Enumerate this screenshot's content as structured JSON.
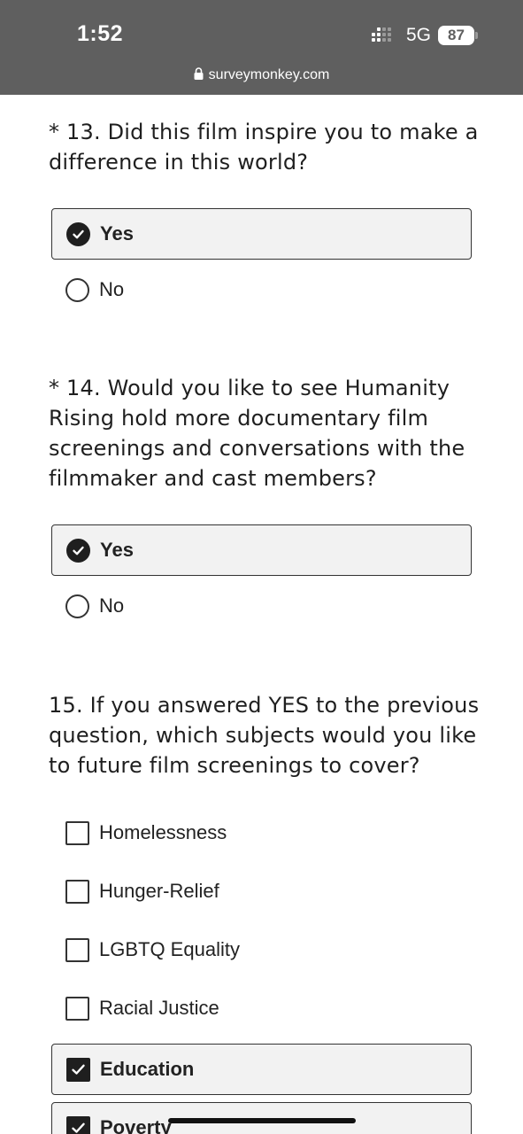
{
  "status_bar": {
    "time": "1:52",
    "network": "5G",
    "battery": "87",
    "url": "surveymonkey.com"
  },
  "questions": [
    {
      "text": "* 13. Did this film inspire you to make a difference in this world?",
      "type": "radio",
      "options": [
        {
          "label": "Yes",
          "selected": true
        },
        {
          "label": "No",
          "selected": false
        }
      ]
    },
    {
      "text": "* 14. Would you like to see Humanity Rising hold more documentary film screenings and conversations with the filmmaker and cast members?",
      "type": "radio",
      "options": [
        {
          "label": "Yes",
          "selected": true
        },
        {
          "label": "No",
          "selected": false
        }
      ]
    },
    {
      "text": "15. If you answered YES to the previous question, which subjects would you like to future film screenings to cover?",
      "type": "checkbox",
      "options": [
        {
          "label": "Homelessness",
          "selected": false
        },
        {
          "label": "Hunger-Relief",
          "selected": false
        },
        {
          "label": "LGBTQ Equality",
          "selected": false
        },
        {
          "label": "Racial Justice",
          "selected": false
        },
        {
          "label": "Education",
          "selected": true
        },
        {
          "label": "Poverty",
          "selected": true
        }
      ]
    }
  ],
  "colors": {
    "status_bar_bg": "#5f5f5f",
    "selected_bg": "#f2f2f2",
    "ink": "#1f1f1f"
  }
}
